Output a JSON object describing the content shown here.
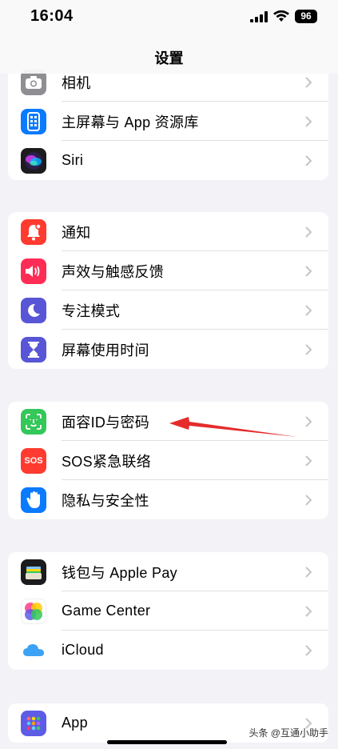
{
  "status": {
    "time": "16:04",
    "battery": "96"
  },
  "nav": {
    "title": "设置"
  },
  "groups": [
    {
      "items": [
        {
          "label": "相机",
          "icon": "camera-icon",
          "color": "#8e8e93"
        },
        {
          "label": "主屏幕与 App 资源库",
          "icon": "home-screen-icon",
          "color": "#0a7aff"
        },
        {
          "label": "Siri",
          "icon": "siri-icon",
          "color": "#1c1c1e"
        }
      ]
    },
    {
      "items": [
        {
          "label": "通知",
          "icon": "notification-bell-icon",
          "color": "#ff3b30"
        },
        {
          "label": "声效与触感反馈",
          "icon": "speaker-icon",
          "color": "#ff2d55"
        },
        {
          "label": "专注模式",
          "icon": "moon-icon",
          "color": "#5856d6"
        },
        {
          "label": "屏幕使用时间",
          "icon": "hourglass-icon",
          "color": "#5856d6"
        }
      ]
    },
    {
      "items": [
        {
          "label": "面容ID与密码",
          "icon": "face-id-icon",
          "color": "#34c759"
        },
        {
          "label": "SOS紧急联络",
          "icon": "sos-icon",
          "color": "#ff3b30",
          "badge": "SOS"
        },
        {
          "label": "隐私与安全性",
          "icon": "hand-icon",
          "color": "#0a7aff"
        }
      ]
    },
    {
      "items": [
        {
          "label": "钱包与 Apple Pay",
          "icon": "wallet-icon",
          "color": "#1c1c1e"
        },
        {
          "label": "Game Center",
          "icon": "game-center-icon",
          "color": "#ffffff"
        },
        {
          "label": "iCloud",
          "icon": "icloud-icon",
          "color": "#ffffff"
        }
      ]
    },
    {
      "items": [
        {
          "label": "App",
          "icon": "apps-grid-icon",
          "color": "#5e5ce6"
        }
      ]
    }
  ],
  "watermark": "头条 @互通小助手",
  "annotation": {
    "color": "#e52b2b"
  }
}
